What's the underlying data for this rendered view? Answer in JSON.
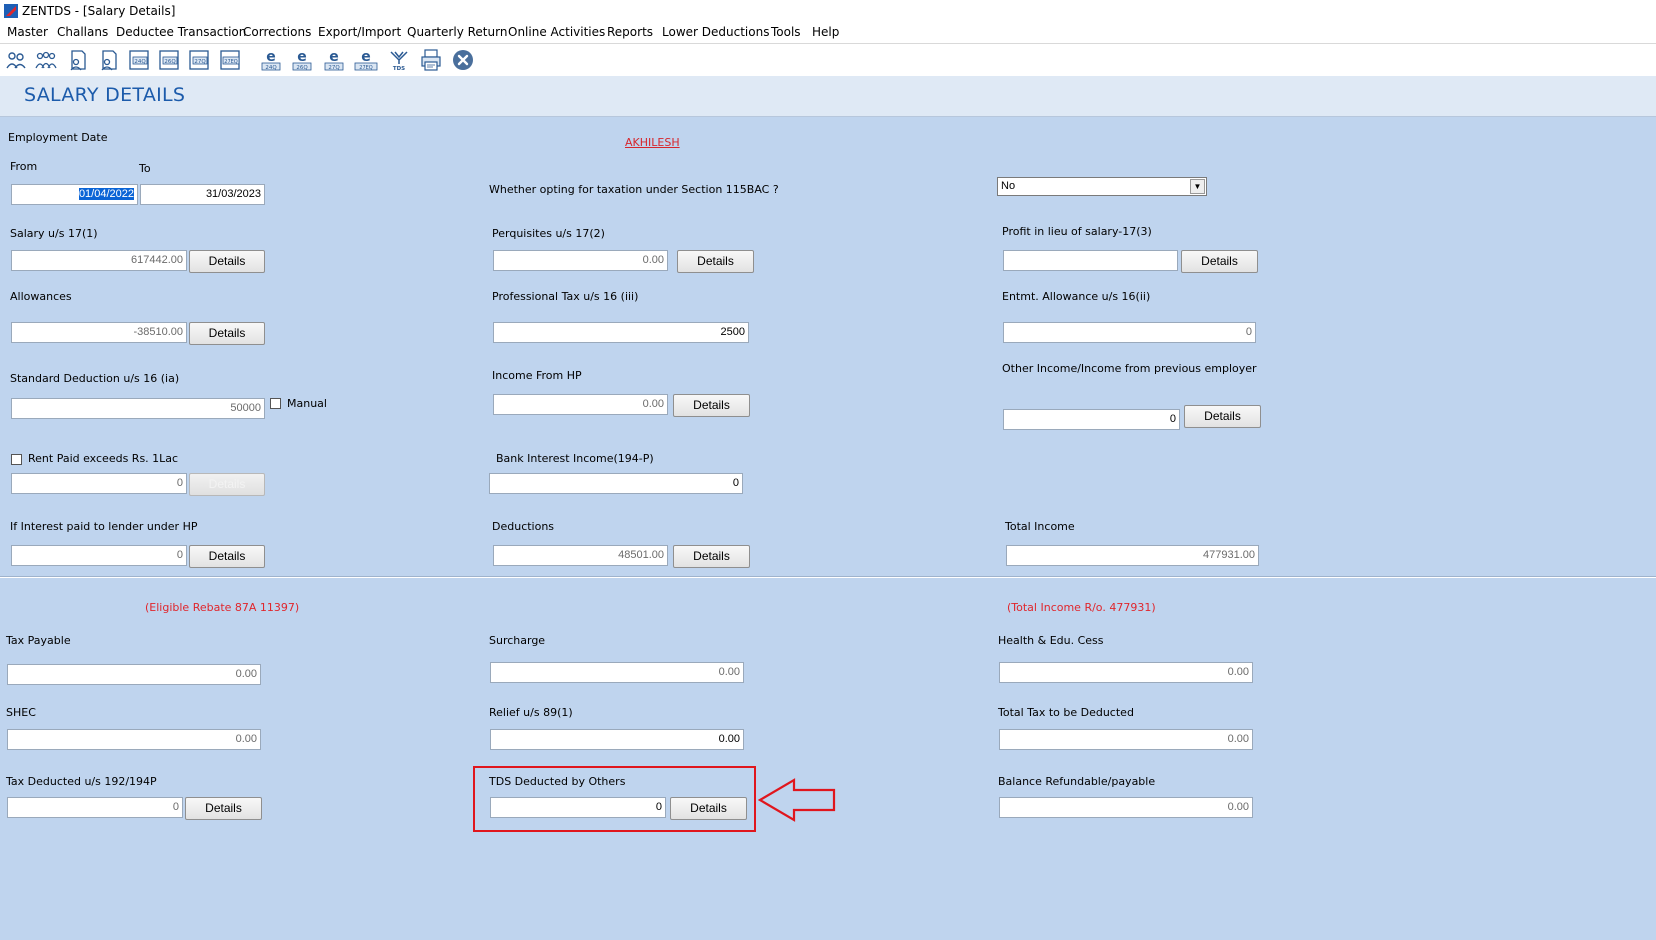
{
  "window": {
    "title": "ZENTDS - [Salary Details]"
  },
  "menu": [
    "Master",
    "Challans",
    "Deductee Transaction",
    "Corrections",
    "Export/Import",
    "Quarterly Return",
    "Online Activities",
    "Reports",
    "Lower Deductions",
    "Tools",
    "Help"
  ],
  "toolbar": {
    "icons": [
      "users-icon",
      "group-icon",
      "document-user-icon",
      "document-user-2-icon",
      "form-24q-icon",
      "form-26q-icon",
      "form-27q-icon",
      "form-27eq-icon",
      "e-24-icon",
      "e-26-icon",
      "e-27-icon",
      "e-27eq-icon",
      "tds-icon",
      "printer-icon",
      "close-icon"
    ],
    "labels": [
      "24Q",
      "26Q",
      "27Q",
      "27EQ",
      "24Q",
      "26Q",
      "27Q",
      "27EQ",
      "TDS"
    ],
    "e_letter": "e"
  },
  "page": {
    "title": "SALARY DETAILS",
    "employee": "AKHILESH"
  },
  "employment": {
    "label": "Employment Date",
    "from_label": "From",
    "to_label": "To",
    "from": "01/04/2022",
    "to": "31/03/2023"
  },
  "section115bac": {
    "label": "Whether opting for taxation under Section 115BAC ?",
    "value": "No"
  },
  "fields": {
    "salary_17_1": {
      "label": "Salary u/s 17(1)",
      "value": "617442.00"
    },
    "perquisites_17_2": {
      "label": "Perquisites u/s 17(2)",
      "value": "0.00"
    },
    "profit_17_3": {
      "label": "Profit in lieu of salary-17(3)",
      "value": ""
    },
    "allowances": {
      "label": "Allowances",
      "value": "-38510.00"
    },
    "professional_tax": {
      "label": "Professional Tax u/s 16 (iii)",
      "value": "2500"
    },
    "entmt_allowance": {
      "label": "Entmt. Allowance u/s 16(ii)",
      "value": "0"
    },
    "standard_deduction": {
      "label": "Standard Deduction u/s 16 (ia)",
      "value": "50000",
      "manual_label": "Manual"
    },
    "income_hp": {
      "label": "Income From HP",
      "value": "0.00"
    },
    "other_income": {
      "label": "Other Income/Income from previous employer",
      "value": "0"
    },
    "rent_paid": {
      "label": "Rent Paid exceeds Rs.  1Lac",
      "value": "0"
    },
    "bank_interest": {
      "label": "Bank Interest Income(194-P)",
      "value": "0"
    },
    "interest_lender": {
      "label": "If Interest paid to lender under HP",
      "value": "0"
    },
    "deductions": {
      "label": "Deductions",
      "value": "48501.00"
    },
    "total_income": {
      "label": "Total Income",
      "value": "477931.00"
    },
    "tax_payable": {
      "label": "Tax Payable",
      "value": "0.00"
    },
    "surcharge": {
      "label": "Surcharge",
      "value": "0.00"
    },
    "health_cess": {
      "label": "Health & Edu. Cess",
      "value": "0.00"
    },
    "shec": {
      "label": "SHEC",
      "value": "0.00"
    },
    "relief_89": {
      "label": "Relief u/s 89(1)",
      "value": "0.00"
    },
    "total_tax": {
      "label": "Total Tax to be Deducted",
      "value": "0.00"
    },
    "tax_deducted_192": {
      "label": "Tax Deducted u/s 192/194P",
      "value": "0"
    },
    "tds_others": {
      "label": "TDS Deducted by Others",
      "value": "0"
    },
    "balance": {
      "label": "Balance Refundable/payable",
      "value": "0.00"
    }
  },
  "notes": {
    "rebate": "(Eligible Rebate 87A 11397)",
    "total_income_ro": "(Total Income R/o. 477931)"
  },
  "buttons": {
    "details": "Details"
  },
  "colors": {
    "title_blue": "#1c5bab",
    "form_bg": "#bfd4ee",
    "note_red": "#e0262c",
    "highlight_red": "#e0161d"
  }
}
